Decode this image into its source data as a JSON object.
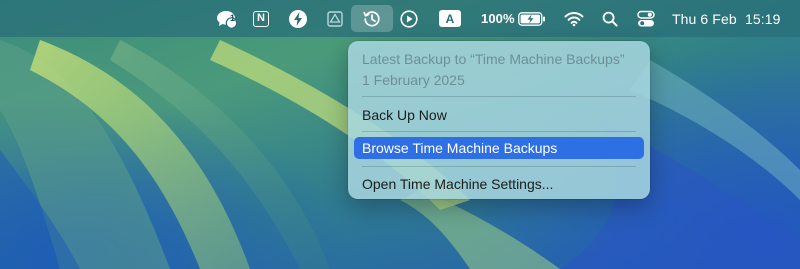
{
  "colors": {
    "menubar_bg": "#286e78",
    "menu_bg": "#a8d6de",
    "selection": "#2f6fe4",
    "disabled_text": "#6c8f97"
  },
  "menubar": {
    "icons": [
      {
        "name": "messages-badge-icon",
        "badge": "1"
      },
      {
        "name": "notion-icon",
        "glyph": "N"
      },
      {
        "name": "bolt-icon"
      },
      {
        "name": "drive-icon"
      },
      {
        "name": "time-machine-icon"
      },
      {
        "name": "play-icon"
      },
      {
        "name": "input-source-icon",
        "glyph": "A"
      },
      {
        "name": "battery-icon"
      },
      {
        "name": "wifi-icon"
      },
      {
        "name": "spotlight-search-icon"
      },
      {
        "name": "control-center-icon"
      }
    ],
    "battery_percent": "100%",
    "date": "Thu 6 Feb",
    "time": "15:19"
  },
  "time_machine_menu": {
    "header_title": "Latest Backup to “Time Machine Backups”",
    "header_date": "1 February 2025",
    "items": [
      {
        "label": "Back Up Now",
        "selected": false
      },
      {
        "label": "Browse Time Machine Backups",
        "selected": true
      },
      {
        "label": "Open Time Machine Settings...",
        "selected": false
      }
    ]
  }
}
